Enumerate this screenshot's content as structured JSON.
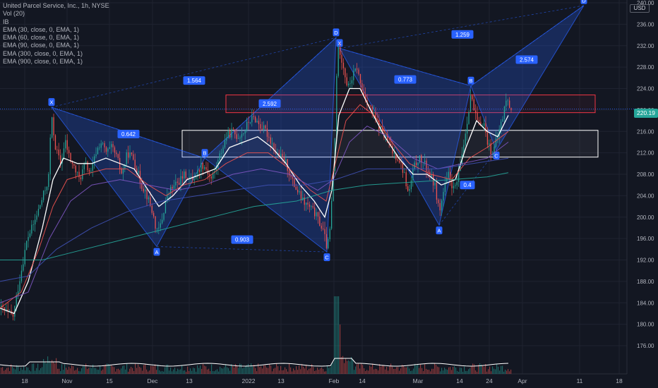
{
  "header": {
    "symbol_line": "United Parcel Service, Inc., 1h, NYSE",
    "indicators": [
      "Vol (20)",
      "IB",
      "EMA (30, close, 0, EMA, 1)",
      "EMA (60, close, 0, EMA, 1)",
      "EMA (90, close, 0, EMA, 1)",
      "EMA (300, close, 0, EMA, 1)",
      "EMA (900, close, 0, EMA, 1)"
    ]
  },
  "price_axis": {
    "currency": "USD",
    "current_price": "220.19",
    "current_price_color": "#26a69a",
    "labels": [
      "240.00",
      "236.00",
      "232.00",
      "228.00",
      "224.00",
      "220.00",
      "216.00",
      "212.00",
      "208.00",
      "204.00",
      "200.00",
      "196.00",
      "192.00",
      "188.00",
      "184.00",
      "180.00",
      "176.00"
    ]
  },
  "colors": {
    "background": "#131722",
    "grid": "#1f2330",
    "up_candle": "#26a69a",
    "down_candle": "#ef5350",
    "pattern_fill": "#2962ff",
    "pattern_label": "#2962ff",
    "ema30": "#ffffff",
    "ema60": "#ef5350",
    "ema90": "#7e57c2",
    "ema300": "#3f51b5",
    "ema900": "#26a69a",
    "zone_red": "#f23645",
    "zone_white": "#ffffff"
  },
  "chart_data": {
    "type": "candlestick",
    "title": "United Parcel Service, Inc., 1h, NYSE",
    "x_ticks": [
      {
        "label": "18",
        "x": 35
      },
      {
        "label": "Nov",
        "x": 95
      },
      {
        "label": "15",
        "x": 155
      },
      {
        "label": "Dec",
        "x": 216
      },
      {
        "label": "13",
        "x": 268
      },
      {
        "label": "2022",
        "x": 352
      },
      {
        "label": "13",
        "x": 398
      },
      {
        "label": "Feb",
        "x": 473
      },
      {
        "label": "14",
        "x": 513
      },
      {
        "label": "Mar",
        "x": 592
      },
      {
        "label": "14",
        "x": 651
      },
      {
        "label": "24",
        "x": 693
      },
      {
        "label": "Apr",
        "x": 740
      },
      {
        "label": "11",
        "x": 821
      },
      {
        "label": "18",
        "x": 877
      }
    ],
    "price_path": [
      [
        0,
        183
      ],
      [
        18,
        181.5
      ],
      [
        28,
        189
      ],
      [
        38,
        196
      ],
      [
        48,
        199
      ],
      [
        58,
        203
      ],
      [
        68,
        207
      ],
      [
        72,
        219
      ],
      [
        78,
        213
      ],
      [
        85,
        210
      ],
      [
        92,
        214
      ],
      [
        98,
        211
      ],
      [
        105,
        209
      ],
      [
        112,
        207
      ],
      [
        120,
        210
      ],
      [
        128,
        208
      ],
      [
        135,
        212
      ],
      [
        142,
        214
      ],
      [
        150,
        212
      ],
      [
        158,
        213
      ],
      [
        165,
        211
      ],
      [
        172,
        208
      ],
      [
        180,
        212
      ],
      [
        188,
        211
      ],
      [
        195,
        208
      ],
      [
        200,
        206
      ],
      [
        205,
        205
      ],
      [
        210,
        203
      ],
      [
        215,
        201
      ],
      [
        222,
        197
      ],
      [
        228,
        199
      ],
      [
        234,
        203
      ],
      [
        240,
        205
      ],
      [
        248,
        206
      ],
      [
        255,
        207
      ],
      [
        262,
        208
      ],
      [
        270,
        207
      ],
      [
        278,
        208
      ],
      [
        285,
        210
      ],
      [
        292,
        209
      ],
      [
        298,
        207
      ],
      [
        305,
        209
      ],
      [
        312,
        212
      ],
      [
        320,
        215
      ],
      [
        328,
        216
      ],
      [
        336,
        215
      ],
      [
        345,
        216
      ],
      [
        352,
        218
      ],
      [
        360,
        218.5
      ],
      [
        368,
        217
      ],
      [
        376,
        216
      ],
      [
        384,
        214
      ],
      [
        390,
        212
      ],
      [
        398,
        211
      ],
      [
        405,
        210
      ],
      [
        412,
        207
      ],
      [
        420,
        205
      ],
      [
        428,
        203
      ],
      [
        436,
        202
      ],
      [
        444,
        201
      ],
      [
        452,
        199
      ],
      [
        458,
        197
      ],
      [
        463,
        194
      ],
      [
        467,
        198
      ],
      [
        470,
        205
      ],
      [
        474,
        215
      ],
      [
        477,
        231
      ],
      [
        481,
        231
      ],
      [
        486,
        228
      ],
      [
        492,
        224
      ],
      [
        498,
        226
      ],
      [
        505,
        228
      ],
      [
        511,
        224
      ],
      [
        518,
        222
      ],
      [
        525,
        220
      ],
      [
        532,
        218
      ],
      [
        540,
        216
      ],
      [
        548,
        214
      ],
      [
        556,
        212
      ],
      [
        564,
        211
      ],
      [
        572,
        208
      ],
      [
        578,
        204
      ],
      [
        585,
        209
      ],
      [
        592,
        211
      ],
      [
        600,
        210
      ],
      [
        608,
        208
      ],
      [
        615,
        206
      ],
      [
        622,
        201
      ],
      [
        628,
        205
      ],
      [
        635,
        208
      ],
      [
        642,
        205
      ],
      [
        648,
        207
      ],
      [
        654,
        212
      ],
      [
        660,
        217
      ],
      [
        666,
        223
      ],
      [
        672,
        219
      ],
      [
        678,
        217
      ],
      [
        684,
        218
      ],
      [
        690,
        214
      ],
      [
        696,
        212
      ],
      [
        700,
        213
      ],
      [
        706,
        216
      ],
      [
        712,
        219
      ],
      [
        716,
        222
      ],
      [
        720,
        221
      ],
      [
        724,
        220.2
      ]
    ],
    "ema_series": [
      {
        "name": "EMA (30, close, 0, EMA, 1)",
        "color": "#ffffff",
        "path": [
          [
            0,
            183
          ],
          [
            20,
            182
          ],
          [
            40,
            188
          ],
          [
            60,
            198
          ],
          [
            75,
            207
          ],
          [
            90,
            211
          ],
          [
            110,
            210
          ],
          [
            130,
            210
          ],
          [
            150,
            211
          ],
          [
            170,
            210
          ],
          [
            190,
            209
          ],
          [
            210,
            205
          ],
          [
            225,
            202
          ],
          [
            245,
            204
          ],
          [
            265,
            207
          ],
          [
            285,
            208
          ],
          [
            305,
            209
          ],
          [
            325,
            213
          ],
          [
            345,
            214
          ],
          [
            365,
            215
          ],
          [
            385,
            213
          ],
          [
            405,
            210
          ],
          [
            425,
            206
          ],
          [
            445,
            203
          ],
          [
            460,
            200
          ],
          [
            470,
            205
          ],
          [
            480,
            219
          ],
          [
            495,
            224
          ],
          [
            510,
            224
          ],
          [
            525,
            220
          ],
          [
            545,
            215
          ],
          [
            565,
            211
          ],
          [
            585,
            208
          ],
          [
            605,
            208
          ],
          [
            625,
            206
          ],
          [
            645,
            207
          ],
          [
            660,
            213
          ],
          [
            675,
            218
          ],
          [
            690,
            216
          ],
          [
            705,
            215
          ],
          [
            720,
            219
          ]
        ]
      },
      {
        "name": "EMA (60, close, 0, EMA, 1)",
        "color": "#ef5350",
        "path": [
          [
            0,
            183
          ],
          [
            30,
            186
          ],
          [
            55,
            194
          ],
          [
            75,
            202
          ],
          [
            95,
            207
          ],
          [
            120,
            208
          ],
          [
            150,
            209
          ],
          [
            180,
            209
          ],
          [
            210,
            206
          ],
          [
            235,
            204
          ],
          [
            260,
            206
          ],
          [
            290,
            207
          ],
          [
            320,
            210
          ],
          [
            350,
            212
          ],
          [
            380,
            212
          ],
          [
            410,
            209
          ],
          [
            440,
            205
          ],
          [
            462,
            203
          ],
          [
            475,
            210
          ],
          [
            490,
            218
          ],
          [
            510,
            221
          ],
          [
            530,
            219
          ],
          [
            555,
            214
          ],
          [
            580,
            210
          ],
          [
            610,
            208
          ],
          [
            640,
            207
          ],
          [
            665,
            211
          ],
          [
            690,
            213
          ],
          [
            720,
            216
          ]
        ]
      },
      {
        "name": "EMA (90, close, 0, EMA, 1)",
        "color": "#7e57c2",
        "path": [
          [
            0,
            184
          ],
          [
            40,
            186
          ],
          [
            70,
            196
          ],
          [
            100,
            203
          ],
          [
            130,
            206
          ],
          [
            170,
            207
          ],
          [
            210,
            206
          ],
          [
            250,
            205
          ],
          [
            290,
            206
          ],
          [
            330,
            208
          ],
          [
            370,
            209
          ],
          [
            410,
            208
          ],
          [
            450,
            205
          ],
          [
            472,
            207
          ],
          [
            495,
            214
          ],
          [
            520,
            217
          ],
          [
            550,
            215
          ],
          [
            585,
            211
          ],
          [
            620,
            209
          ],
          [
            655,
            210
          ],
          [
            690,
            211
          ],
          [
            720,
            214
          ]
        ]
      },
      {
        "name": "EMA (300, close, 0, EMA, 1)",
        "color": "#3f51b5",
        "path": [
          [
            0,
            188
          ],
          [
            40,
            189
          ],
          [
            80,
            194
          ],
          [
            130,
            198
          ],
          [
            180,
            201
          ],
          [
            230,
            203
          ],
          [
            280,
            204
          ],
          [
            330,
            205
          ],
          [
            380,
            206
          ],
          [
            430,
            206
          ],
          [
            475,
            207
          ],
          [
            520,
            209
          ],
          [
            570,
            209
          ],
          [
            620,
            209
          ],
          [
            670,
            210
          ],
          [
            720,
            211
          ]
        ]
      },
      {
        "name": "EMA (900, close, 0, EMA, 1)",
        "color": "#26a69a",
        "path": [
          [
            0,
            192
          ],
          [
            60,
            192
          ],
          [
            120,
            194
          ],
          [
            180,
            196
          ],
          [
            240,
            198
          ],
          [
            300,
            200
          ],
          [
            360,
            202
          ],
          [
            420,
            203
          ],
          [
            470,
            205
          ],
          [
            520,
            206
          ],
          [
            580,
            206.5
          ],
          [
            640,
            207
          ],
          [
            690,
            207.5
          ],
          [
            720,
            208.3
          ]
        ]
      }
    ],
    "harmonic_patterns": [
      {
        "points": [
          {
            "label": "X",
            "x": 73,
            "p": 220.5
          },
          {
            "label": "A",
            "x": 222,
            "p": 194.5
          },
          {
            "label": "B",
            "x": 290,
            "p": 211
          },
          {
            "label": "C",
            "x": 463,
            "p": 193.5
          },
          {
            "label": "D",
            "x": 476,
            "p": 233.5
          }
        ],
        "ratios": [
          {
            "text": "0.642",
            "x": 182,
            "p": 215.5
          },
          {
            "text": "0.903",
            "x": 343,
            "p": 195.8
          },
          {
            "text": "2.592",
            "x": 382,
            "p": 221.2
          },
          {
            "text": "1.564",
            "x": 275,
            "p": 225.5
          }
        ]
      },
      {
        "points": [
          {
            "label": "X",
            "x": 481,
            "p": 231.5
          },
          {
            "label": "A",
            "x": 622,
            "p": 198.5
          },
          {
            "label": "B",
            "x": 667,
            "p": 224.5
          },
          {
            "label": "C",
            "x": 703,
            "p": 212.5
          },
          {
            "label": "D",
            "x": 827,
            "p": 239.5
          }
        ],
        "ratios": [
          {
            "text": "0.773",
            "x": 574,
            "p": 225.7
          },
          {
            "text": "0.4",
            "x": 662,
            "p": 206
          },
          {
            "text": "2.574",
            "x": 746,
            "p": 229.4
          },
          {
            "text": "1.259",
            "x": 655,
            "p": 234.1
          }
        ]
      }
    ],
    "zones": [
      {
        "color": "red",
        "top": 222.8,
        "bottom": 219.5,
        "x1": 320,
        "x2": 843
      },
      {
        "color": "white",
        "top": 216.2,
        "bottom": 211.2,
        "x1": 258,
        "x2": 847
      }
    ],
    "volume_note": "Vol (20)",
    "ylim": [
      174,
      241
    ],
    "grid": true
  }
}
